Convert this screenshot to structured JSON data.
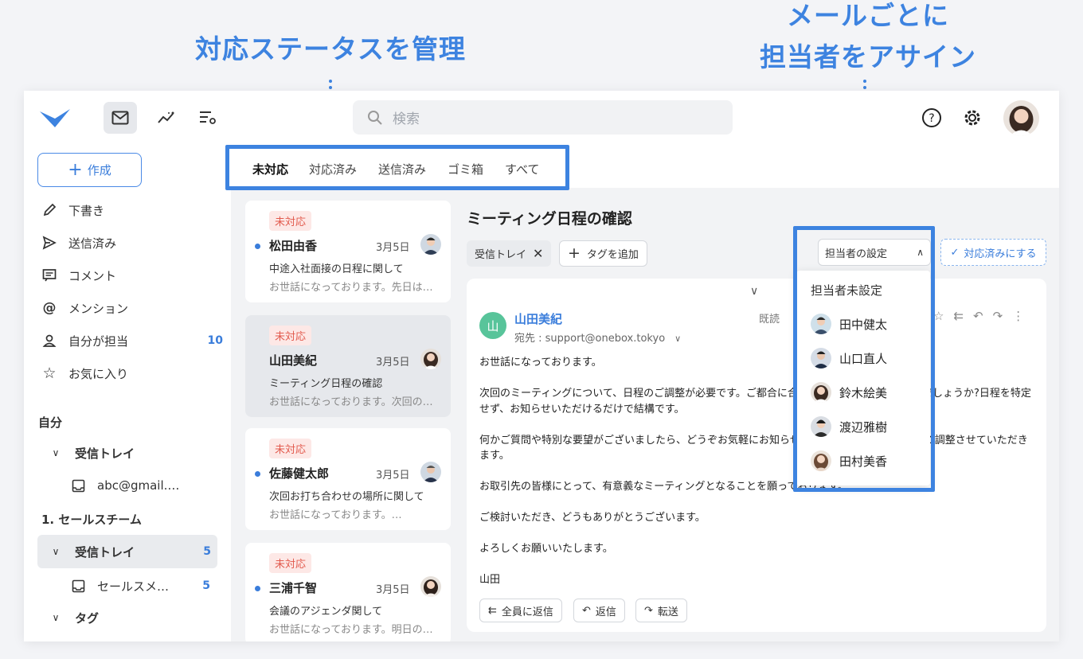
{
  "callouts": {
    "status": "対応ステータスを管理",
    "assign_line1": "メールごとに",
    "assign_line2": "担当者をアサイン"
  },
  "search": {
    "placeholder": "検索"
  },
  "sidebar": {
    "compose": "作成",
    "items": [
      {
        "label": "下書き",
        "icon": "pencil-icon"
      },
      {
        "label": "送信済み",
        "icon": "send-icon"
      },
      {
        "label": "コメント",
        "icon": "comment-icon"
      },
      {
        "label": "メンション",
        "icon": "at-icon"
      },
      {
        "label": "自分が担当",
        "icon": "person-icon",
        "count": "10"
      },
      {
        "label": "お気に入り",
        "icon": "star-icon"
      }
    ],
    "section_self": "自分",
    "self_inbox": "受信トレイ",
    "self_account": "abc@gmail.…",
    "section_team": "1. セールスチーム",
    "team_inbox": "受信トレイ",
    "team_inbox_count": "5",
    "team_account": "セールスメ…",
    "team_account_count": "5",
    "tags": "タグ"
  },
  "tabs": [
    "未対応",
    "対応済み",
    "送信済み",
    "ゴミ箱",
    "すべて"
  ],
  "mail_list": [
    {
      "badge": "未対応",
      "name": "松田由香",
      "date": "3月5日",
      "subject": "中途入社面接の日程に関して",
      "preview": "お世話になっております。先日は…",
      "avatar": "male"
    },
    {
      "badge": "未対応",
      "name": "山田美紀",
      "date": "3月5日",
      "subject": "ミーティング日程の確認",
      "preview": "お世話になっております。次回の…",
      "avatar": "female"
    },
    {
      "badge": "未対応",
      "name": "佐藤健太郎",
      "date": "3月5日",
      "subject": "次回お打ち合わせの場所に関して",
      "preview": "お世話になっております。…",
      "avatar": "male"
    },
    {
      "badge": "未対応",
      "name": "三浦千智",
      "date": "3月5日",
      "subject": "会議のアジェンダ関して",
      "preview": "お世話になっております。明日の…",
      "avatar": "female"
    }
  ],
  "detail": {
    "title": "ミーティング日程の確認",
    "tag_inbox": "受信トレイ",
    "add_tag": "タグを追加",
    "assign_select": "担当者の設定",
    "mark_done": "対応済みにする",
    "sender_initial": "山",
    "sender_name": "山田美紀",
    "to": "宛先 : support@onebox.tokyo",
    "read": "既読",
    "body": [
      "お世話になっております。",
      "次回のミーティングについて、日程のご調整が必要です。ご都合に合わせてご連絡いただけますでしょうか?日程を特定せず、お知らせいただけるだけで結構です。",
      "何かご質問や特別な要望がございましたら、どうぞお気軽にお知らせください。ご都合に合わせて調整させていただきます。",
      "お取引先の皆様にとって、有意義なミーティングとなることを願っております。",
      "ご検討いただき、どうもありがとうございます。",
      "よろしくお願いいたします。",
      "山田"
    ],
    "reply_all": "全員に返信",
    "reply": "返信",
    "forward": "転送"
  },
  "assignee_dropdown": {
    "unassigned": "担当者未設定",
    "people": [
      {
        "name": "田中健太",
        "avatar": "male"
      },
      {
        "name": "山口直人",
        "avatar": "male"
      },
      {
        "name": "鈴木絵美",
        "avatar": "female"
      },
      {
        "name": "渡辺雅樹",
        "avatar": "male"
      },
      {
        "name": "田村美香",
        "avatar": "female"
      }
    ]
  },
  "colors": {
    "accent": "#3d83e0",
    "badge_text": "#e25a4d",
    "badge_bg": "#fde8e6"
  }
}
